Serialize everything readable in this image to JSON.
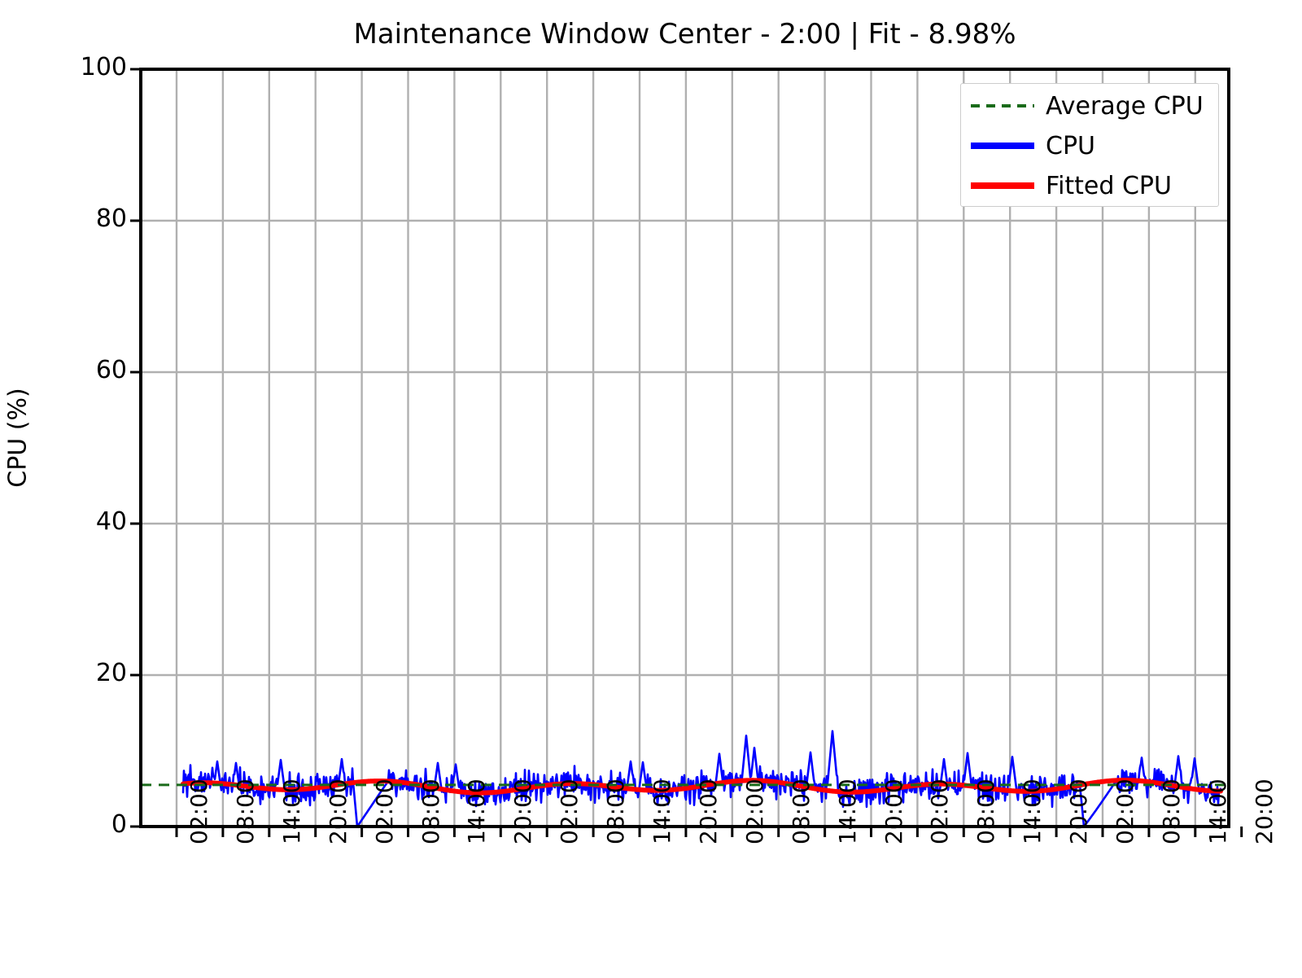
{
  "chart_data": {
    "type": "line",
    "title": "Maintenance Window Center - 2:00 | Fit - 8.98%",
    "xlabel": "",
    "ylabel": "CPU (%)",
    "ylim": [
      0,
      100
    ],
    "yticks": [
      0,
      20,
      40,
      60,
      80,
      100
    ],
    "ytick_labels": [
      "0",
      "20",
      "40",
      "60",
      "80",
      "100"
    ],
    "grid": true,
    "legend_position": "upper right",
    "xtick_labels": [
      "02:00",
      "08:00",
      "14:00",
      "20:00",
      "02:00",
      "08:00",
      "14:00",
      "20:00",
      "02:00",
      "08:00",
      "14:00",
      "20:00",
      "02:00",
      "08:00",
      "14:00",
      "20:00",
      "02:00",
      "08:00",
      "14:00",
      "20:00",
      "02:00",
      "08:00",
      "14:00",
      "20:00"
    ],
    "series": [
      {
        "name": "Average CPU",
        "color": "#1a6b1a",
        "style": "dashed",
        "type": "hline",
        "value": 5.5
      },
      {
        "name": "CPU",
        "color": "#0000ff",
        "style": "solid",
        "type": "noisy-line",
        "baseline_mean": 5.3,
        "noise_amplitude": 1.9,
        "min": 0.0,
        "max": 12.6,
        "drops_to_zero_at": [
          "02:00 (day 2)",
          "02:00 (day 6)"
        ],
        "spike_values": [
          12.0,
          12.6,
          9.5
        ],
        "note": "Per-minute CPU utilisation oscillating between about 3% and 8% with occasional spikes up to about 12.6% and two maintenance drop-outs reaching 0%."
      },
      {
        "name": "Fitted CPU",
        "color": "#ff0000",
        "style": "solid",
        "type": "smooth-line",
        "min": 4.4,
        "max": 6.1,
        "note": "Smooth sinusoidal fit of the daily CPU profile, oscillating roughly between 4.4% and 6.1%."
      }
    ]
  },
  "title": {
    "text": "Maintenance Window Center - 2:00 | Fit - 8.98%"
  },
  "axes": {
    "ylabel": "CPU (%)",
    "ytick_labels": [
      "100",
      "80",
      "60",
      "40",
      "20",
      "0"
    ]
  },
  "legend": {
    "entries": [
      {
        "label": "Average CPU",
        "color": "#1a6b1a"
      },
      {
        "label": "CPU",
        "color": "#0000ff"
      },
      {
        "label": "Fitted CPU",
        "color": "#ff0000"
      }
    ]
  }
}
